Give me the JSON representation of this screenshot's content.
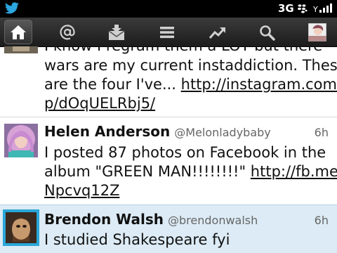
{
  "status": {
    "network": "3G"
  },
  "nav": {
    "items": [
      {
        "icon": "home-icon"
      },
      {
        "icon": "mentions-icon"
      },
      {
        "icon": "direct-messages-icon"
      },
      {
        "icon": "lists-icon"
      },
      {
        "icon": "trends-icon"
      },
      {
        "icon": "search-icon"
      },
      {
        "icon": "profile-avatar-icon"
      }
    ]
  },
  "tweets": [
    {
      "line1": "I know I regram them a LOT but there",
      "line2": "wars are my current instaddiction. These",
      "line3_text": "are the four I've... ",
      "line3_link": "http://instagram.com/",
      "line4_link": "p/dOqUELRbj5/"
    },
    {
      "name": "Helen Anderson",
      "handle": "@Melonladybaby",
      "time": "6h",
      "line1": "I posted 87 photos on Facebook in the",
      "line2_text": "album \"GREEN MAN!!!!!!!!\" ",
      "line2_link": "http://fb.me/",
      "line3_link": "Npcvq12Z"
    },
    {
      "name": "Brendon Walsh",
      "handle": "@brendonwalsh",
      "time": "6h",
      "line1": "I studied Shakespeare fyi"
    }
  ],
  "colors": {
    "status_bar": "#000000",
    "nav_bar": "#2a2a2a",
    "selected_row": "#dcebf5",
    "avatar_frame": "#2aa6d8"
  }
}
